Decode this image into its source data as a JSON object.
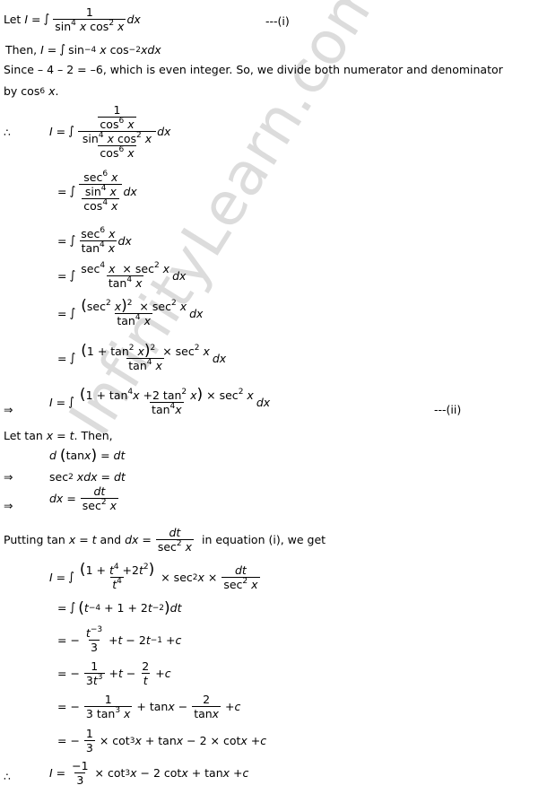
{
  "watermark": "InfinityLearn.com",
  "labels": {
    "eq1": "---(i)",
    "eq2": "---(ii)"
  },
  "text": {
    "let": "Let",
    "then": "Then,",
    "since": "Since  – 4 – 2 = –6,  which is even integer. So, we divide both numerator and denominator",
    "by": "by  cos",
    "let_tan": "Let  tan",
    "then2": ". Then,",
    "putting": "Putting  tan",
    "and": "and",
    "in_equation": "in equation  (i), we get"
  },
  "symbols": {
    "therefore": "∴",
    "implies": "⇒",
    "integral": "∫"
  }
}
